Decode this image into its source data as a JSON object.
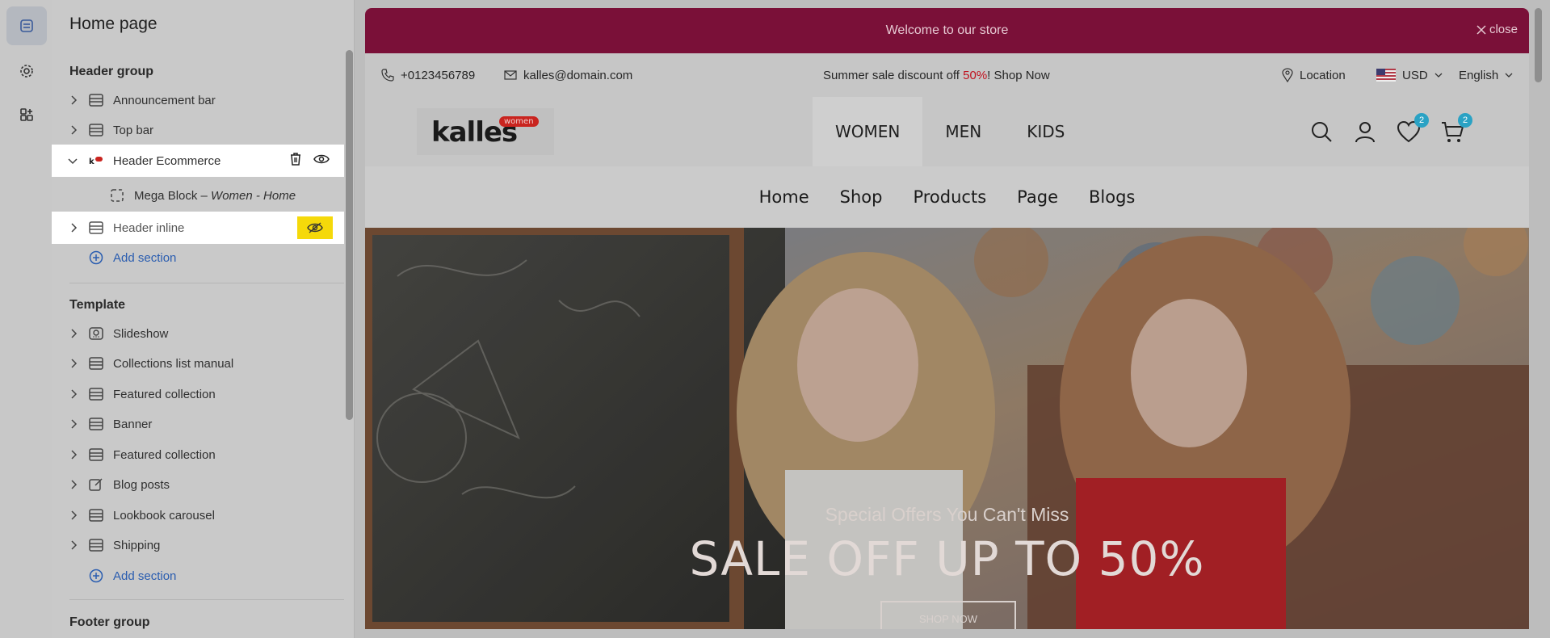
{
  "panel": {
    "title": "Home page",
    "header_group": {
      "title": "Header group",
      "items": [
        {
          "label": "Announcement bar"
        },
        {
          "label": "Top bar"
        },
        {
          "label": "Header Ecommerce"
        },
        {
          "label": "Header inline"
        }
      ],
      "sub_item": {
        "label": "Mega Block – ",
        "label_em": "Women - Home"
      },
      "add_label": "Add section"
    },
    "template": {
      "title": "Template",
      "items": [
        {
          "label": "Slideshow"
        },
        {
          "label": "Collections list manual"
        },
        {
          "label": "Featured collection"
        },
        {
          "label": "Banner"
        },
        {
          "label": "Featured collection"
        },
        {
          "label": "Blog posts"
        },
        {
          "label": "Lookbook carousel"
        },
        {
          "label": "Shipping"
        }
      ],
      "add_label": "Add section"
    },
    "footer_group": {
      "title": "Footer group"
    }
  },
  "store": {
    "announcement": "Welcome to our store",
    "close_label": "close",
    "topbar": {
      "phone": "+0123456789",
      "email": "kalles@domain.com",
      "promo_prefix": "Summer sale discount off ",
      "promo_highlight": "50%",
      "promo_suffix": "! Shop Now",
      "location": "Location",
      "currency": "USD",
      "language": "English"
    },
    "logo": {
      "text": "kalles",
      "badge": "women"
    },
    "categories": [
      "WOMEN",
      "MEN",
      "KIDS"
    ],
    "wishlist_count": "2",
    "cart_count": "2",
    "nav": [
      "Home",
      "Shop",
      "Products",
      "Page",
      "Blogs"
    ],
    "hero": {
      "subtitle": "Special Offers You Can't Miss",
      "title": "SALE OFF UP TO 50%",
      "button": "SHOP NOW"
    }
  },
  "colors": {
    "announcement_bg": "#7a1038",
    "promo_highlight": "#c0121f",
    "link_blue": "#2a5db0",
    "hidden_badge": "#f5d90a",
    "count_badge": "#2aa2c4"
  }
}
